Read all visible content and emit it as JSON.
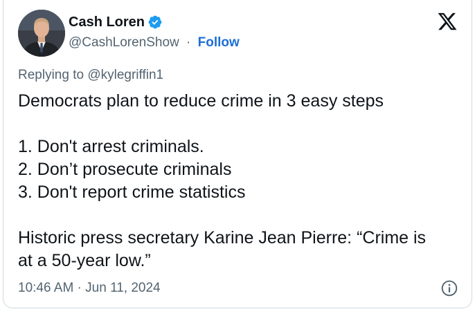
{
  "author": {
    "display_name": "Cash Loren",
    "handle": "@CashLorenShow",
    "separator": "·",
    "follow_label": "Follow",
    "verified_icon": "verified-badge-icon",
    "verified_color": "#1d9bf0"
  },
  "brand": {
    "logo_icon": "x-logo-icon"
  },
  "reply": {
    "label": "Replying to @kylegriffin1"
  },
  "tweet": {
    "line_1": "Democrats plan to reduce crime in 3 easy steps",
    "line_2": "1. Don't arrest criminals.",
    "line_3": "2. Don’t prosecute criminals",
    "line_4": "3. Don't report crime statistics",
    "line_5": "Historic press secretary Karine Jean Pierre: “Crime is",
    "line_6": "at a 50-year low.”"
  },
  "meta": {
    "timestamp": "10:46 AM · Jun 11, 2024",
    "info_icon": "info-icon"
  },
  "colors": {
    "text": "#0f1419",
    "secondary": "#536471",
    "link": "#1d6fd6",
    "border": "#cfd9de"
  }
}
